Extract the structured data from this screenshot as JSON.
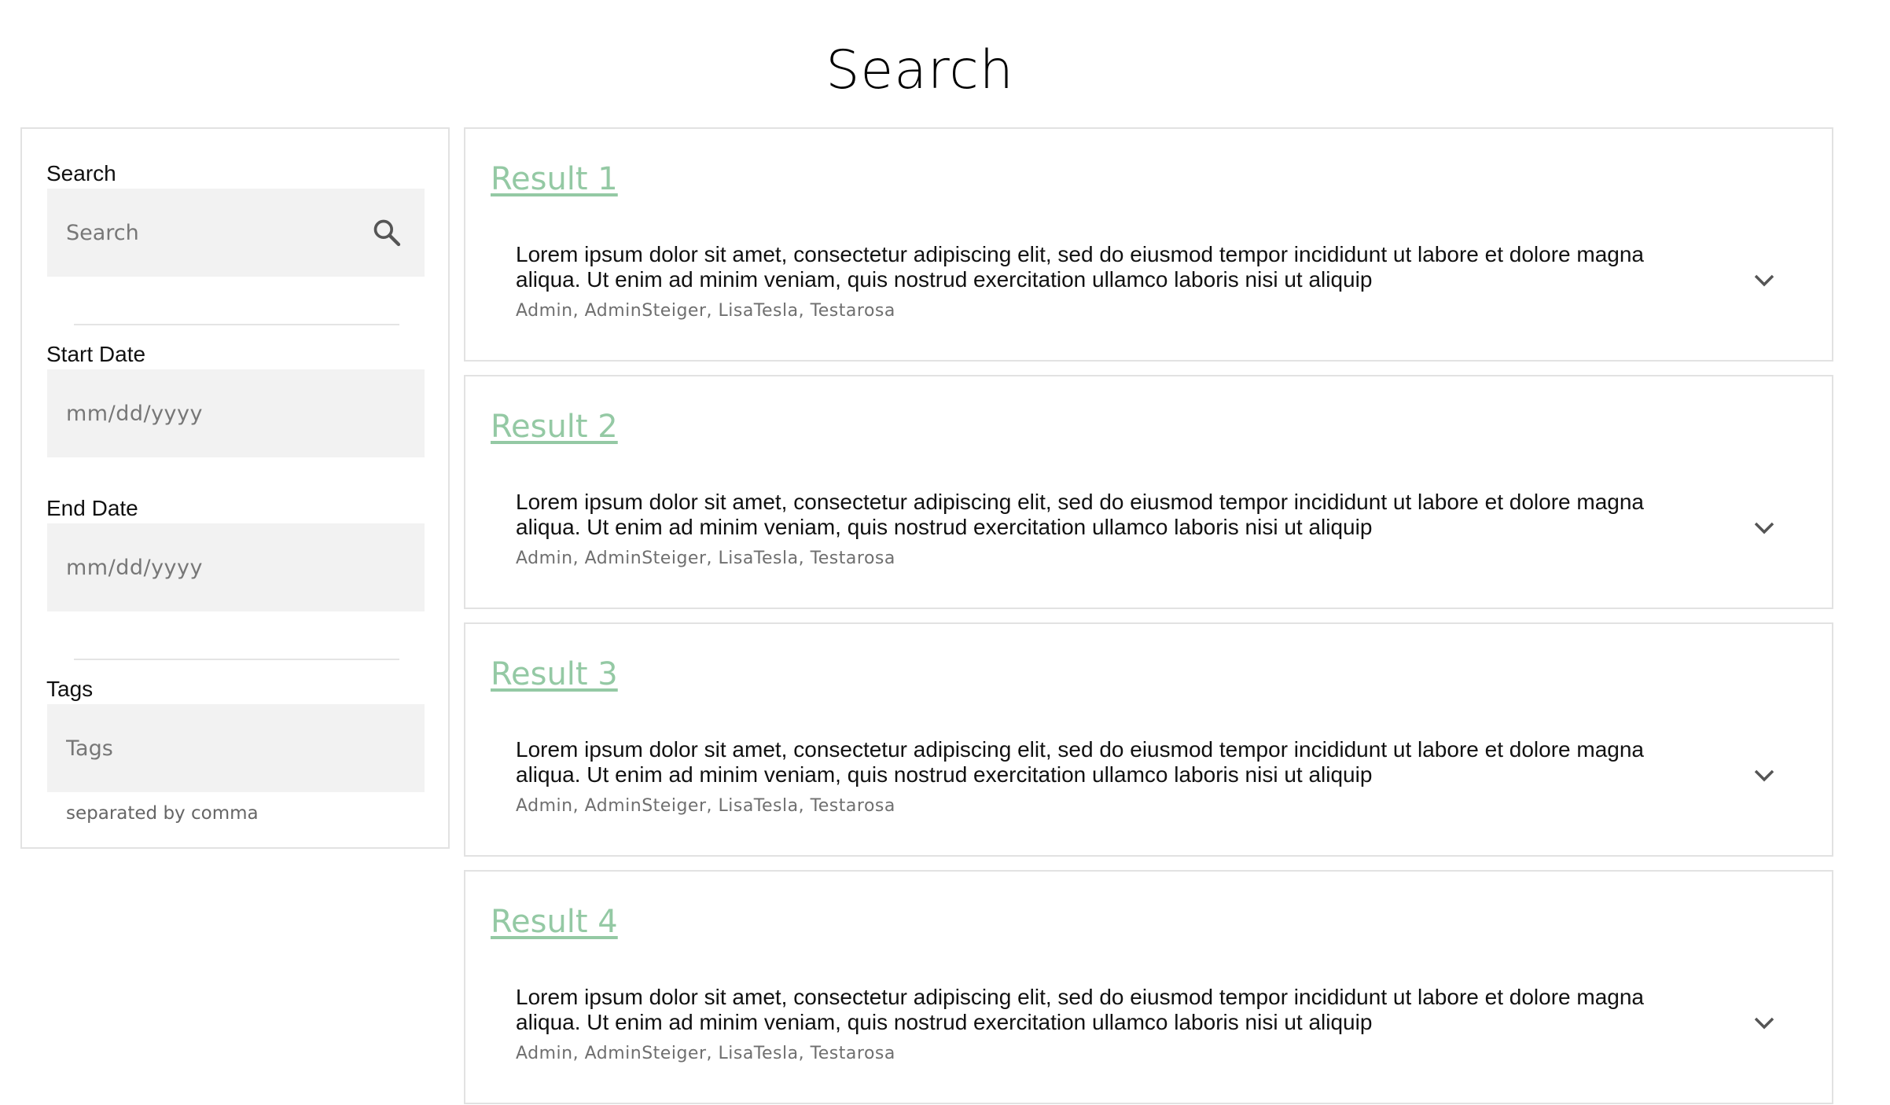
{
  "page": {
    "title": "Search"
  },
  "sidebar": {
    "search": {
      "label": "Search",
      "placeholder": "Search",
      "icon": "search-icon"
    },
    "start_date": {
      "label": "Start Date",
      "placeholder": "mm/dd/yyyy"
    },
    "end_date": {
      "label": "End Date",
      "placeholder": "mm/dd/yyyy"
    },
    "tags": {
      "label": "Tags",
      "placeholder": "Tags",
      "help": "separated by comma"
    }
  },
  "results": [
    {
      "title": "Result 1",
      "body": "Lorem ipsum dolor sit amet, consectetur adipiscing elit, sed do eiusmod tempor incididunt ut labore et dolore magna aliqua. Ut enim ad minim veniam, quis nostrud exercitation ullamco laboris nisi ut aliquip",
      "authors": "Admin, AdminSteiger, LisaTesla, Testarosa"
    },
    {
      "title": "Result 2",
      "body": "Lorem ipsum dolor sit amet, consectetur adipiscing elit, sed do eiusmod tempor incididunt ut labore et dolore magna aliqua. Ut enim ad minim veniam, quis nostrud exercitation ullamco laboris nisi ut aliquip",
      "authors": "Admin, AdminSteiger, LisaTesla, Testarosa"
    },
    {
      "title": "Result 3",
      "body": "Lorem ipsum dolor sit amet, consectetur adipiscing elit, sed do eiusmod tempor incididunt ut labore et dolore magna aliqua. Ut enim ad minim veniam, quis nostrud exercitation ullamco laboris nisi ut aliquip",
      "authors": "Admin, AdminSteiger, LisaTesla, Testarosa"
    },
    {
      "title": "Result 4",
      "body": "Lorem ipsum dolor sit amet, consectetur adipiscing elit, sed do eiusmod tempor incididunt ut labore et dolore magna aliqua. Ut enim ad minim veniam, quis nostrud exercitation ullamco laboris nisi ut aliquip",
      "authors": "Admin, AdminSteiger, LisaTesla, Testarosa"
    }
  ],
  "colors": {
    "link": "#94c9a4",
    "field_bg": "#f2f2f2",
    "border": "#e2e2e2"
  }
}
